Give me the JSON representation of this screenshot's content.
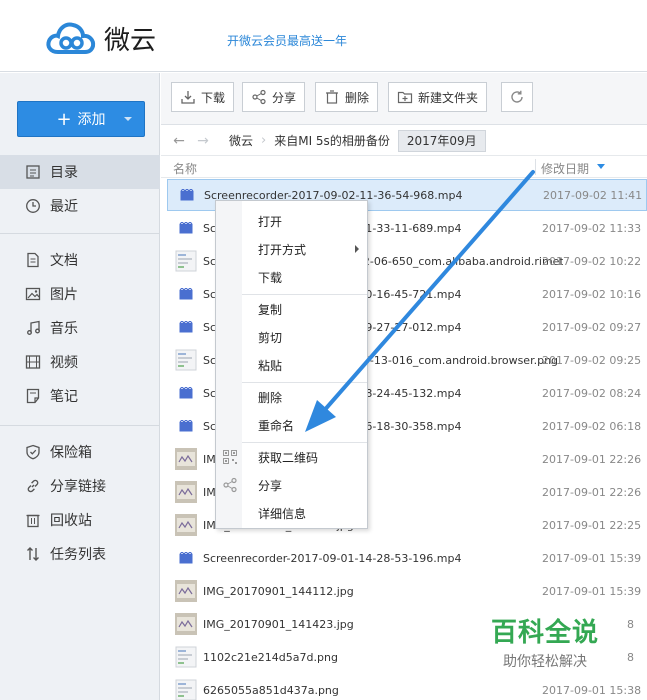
{
  "header": {
    "logo_text": "微云",
    "promo": "开微云会员最高送一年"
  },
  "sidebar": {
    "add_label": "添加",
    "items": [
      {
        "label": "目录",
        "icon": "list-icon",
        "active": true
      },
      {
        "label": "最近",
        "icon": "clock-icon"
      },
      {
        "label": "文档",
        "icon": "document-icon"
      },
      {
        "label": "图片",
        "icon": "image-icon"
      },
      {
        "label": "音乐",
        "icon": "music-icon"
      },
      {
        "label": "视频",
        "icon": "video-icon"
      },
      {
        "label": "笔记",
        "icon": "note-icon"
      },
      {
        "label": "保险箱",
        "icon": "shield-icon"
      },
      {
        "label": "分享链接",
        "icon": "link-icon"
      },
      {
        "label": "回收站",
        "icon": "trash-icon"
      },
      {
        "label": "任务列表",
        "icon": "transfer-icon"
      }
    ]
  },
  "toolbar": {
    "download": "下载",
    "share": "分享",
    "delete": "删除",
    "new_folder": "新建文件夹"
  },
  "breadcrumb": [
    "微云",
    "来自MI 5s的相册备份",
    "2017年09月"
  ],
  "columns": {
    "name": "名称",
    "modified": "修改日期"
  },
  "files": [
    {
      "name": "Screenrecorder-2017-09-02-11-36-54-968.mp4",
      "date": "2017-09-02 11:41",
      "type": "video"
    },
    {
      "name": "Screenrecorder-2017-09-02-11-33-11-689.mp4",
      "date": "2017-09-02 11:33",
      "type": "video"
    },
    {
      "name": "Screenshot_2017-09-02-10-22-06-650_com.alibaba.android.rimet.png",
      "date": "2017-09-02 10:22",
      "type": "image"
    },
    {
      "name": "Screenrecorder-2017-09-02-10-16-45-721.mp4",
      "date": "2017-09-02 10:16",
      "type": "video"
    },
    {
      "name": "Screenrecorder-2017-09-02-09-27-27-012.mp4",
      "date": "2017-09-02 09:27",
      "type": "video"
    },
    {
      "name": "Screenshot_2017-09-02-09-25-13-016_com.android.browser.png",
      "date": "2017-09-02 09:25",
      "type": "image"
    },
    {
      "name": "Screenrecorder-2017-09-02-08-24-45-132.mp4",
      "date": "2017-09-02 08:24",
      "type": "video"
    },
    {
      "name": "Screenrecorder-2017-09-02-06-18-30-358.mp4",
      "date": "2017-09-02 06:18",
      "type": "video"
    },
    {
      "name": "IMG_20170901_222640.jpg",
      "date": "2017-09-01 22:26",
      "type": "photo"
    },
    {
      "name": "IMG_20170901_222612.jpg",
      "date": "2017-09-01 22:26",
      "type": "photo"
    },
    {
      "name": "IMG_20170901_222530.jpg",
      "date": "2017-09-01 22:25",
      "type": "photo"
    },
    {
      "name": "Screenrecorder-2017-09-01-14-28-53-196.mp4",
      "date": "2017-09-01 15:39",
      "type": "video"
    },
    {
      "name": "IMG_20170901_144112.jpg",
      "date": "2017-09-01 15:39",
      "type": "photo"
    },
    {
      "name": "IMG_20170901_141423.jpg",
      "date": "8",
      "type": "photo"
    },
    {
      "name": "1102c21e214d5a7d.png",
      "date": "8",
      "type": "image"
    },
    {
      "name": "6265055a851d437a.png",
      "date": "2017-09-01 15:38",
      "type": "image"
    }
  ],
  "context_menu": {
    "open": "打开",
    "open_with": "打开方式",
    "download": "下载",
    "copy": "复制",
    "cut": "剪切",
    "paste": "粘贴",
    "delete": "删除",
    "rename": "重命名",
    "qrcode": "获取二维码",
    "share": "分享",
    "details": "详细信息"
  },
  "watermark": {
    "line1": "百科全说",
    "line2": "助你轻松解决"
  },
  "colors": {
    "accent": "#2d8ce3",
    "arrow": "#2f88de",
    "watermark": "#34a853"
  }
}
